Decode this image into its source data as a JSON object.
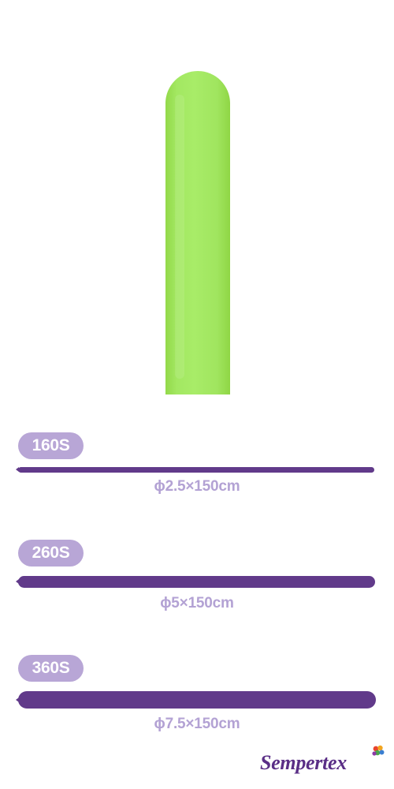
{
  "sizes": [
    {
      "model": "160S",
      "dimension": "ϕ2.5×150cm"
    },
    {
      "model": "260S",
      "dimension": "ϕ5×150cm"
    },
    {
      "model": "360S",
      "dimension": "ϕ7.5×150cm"
    }
  ],
  "brand": {
    "name": "Sempertex",
    "logo_mark": "balloon-cluster-icon"
  },
  "colors": {
    "balloon": "#a6ea66",
    "bar": "#613a8a",
    "pill_background": "#b8a6d6",
    "dimension_text": "#b3a2d4",
    "brand_text": "#5a2e86"
  }
}
